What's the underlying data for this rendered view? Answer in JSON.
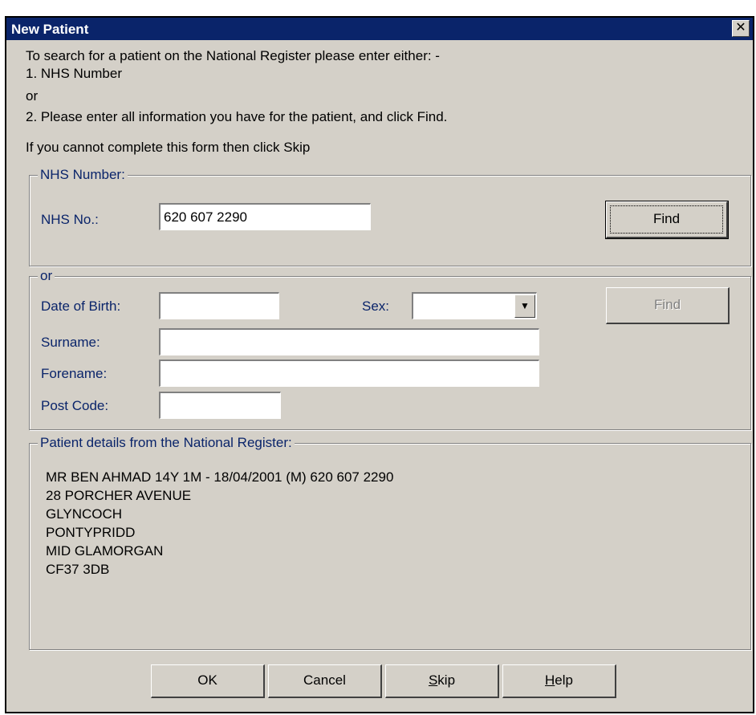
{
  "window": {
    "title": "New Patient",
    "close_glyph": "✕"
  },
  "instructions": {
    "line1": "To search for a patient on the National Register please enter either: -",
    "line2": "1. NHS Number",
    "line3": "or",
    "line4": "2. Please enter all information you have for the patient, and click Find.",
    "line5": "If you cannot complete this form then click Skip"
  },
  "nhs_group": {
    "legend": "NHS Number:",
    "nhs_label": "NHS No.:",
    "nhs_value": "620 607 2290",
    "find_label": "Find"
  },
  "or_group": {
    "legend": "or",
    "dob_label": "Date of Birth:",
    "dob_value": "",
    "sex_label": "Sex:",
    "sex_value": "",
    "surname_label": "Surname:",
    "surname_value": "",
    "forename_label": "Forename:",
    "forename_value": "",
    "postcode_label": "Post Code:",
    "postcode_value": "",
    "find_label": "Find"
  },
  "details_group": {
    "legend": "Patient details from the National Register:",
    "lines": [
      "MR BEN AHMAD 14Y 1M - 18/04/2001 (M) 620 607 2290",
      "28 PORCHER AVENUE",
      "GLYNCOCH",
      "PONTYPRIDD",
      "MID GLAMORGAN",
      "CF37 3DB"
    ]
  },
  "buttons": {
    "ok": "OK",
    "cancel": "Cancel",
    "skip_mnemonic": "S",
    "skip_rest": "kip",
    "help_mnemonic": "H",
    "help_rest": "elp"
  },
  "icons": {
    "dropdown_arrow": "▼"
  },
  "colors": {
    "titlebar": "#0a246a",
    "face": "#d4d0c8",
    "label": "#0a246a"
  }
}
